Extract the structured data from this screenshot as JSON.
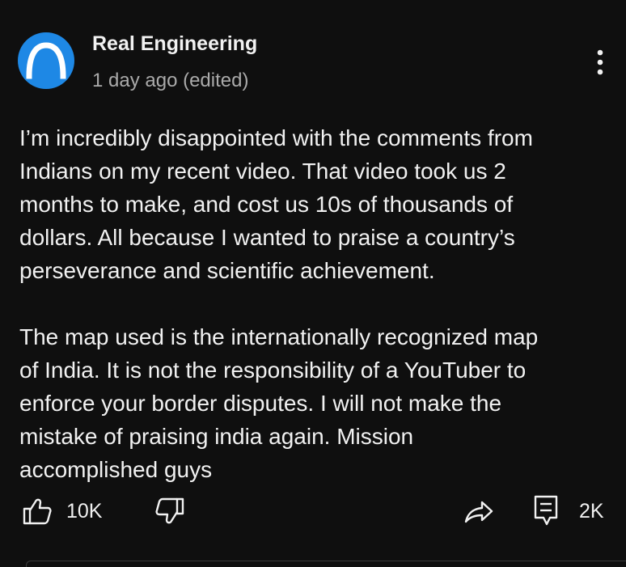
{
  "comment": {
    "author": "Real Engineering",
    "timestamp": "1 day ago (edited)",
    "avatar_icon": "arch-logo-icon",
    "avatar_color": "#1e88e5",
    "paragraphs": [
      [
        "I’m incredibly disappointed with the comments from",
        "Indians on my recent video. That video took us 2",
        "months to make, and cost us 10s of thousands of",
        "dollars. All because I wanted to praise a country’s",
        "perseverance and scientific achievement."
      ],
      [
        "The map used is the internationally recognized map",
        "of India. It is not the responsibility of a YouTuber to",
        "enforce your border disputes. I will not make the",
        "mistake of praising india again. Mission",
        "accomplished guys"
      ]
    ]
  },
  "actions": {
    "like_icon": "thumbs-up-icon",
    "like_count": "10K",
    "dislike_icon": "thumbs-down-icon",
    "share_icon": "share-icon",
    "replies_icon": "comment-icon",
    "reply_count": "2K",
    "more_icon": "more-vertical-icon"
  },
  "colors": {
    "background": "#0f0f0f",
    "text_primary": "#f1f1f1",
    "text_secondary": "#aaaaaa"
  }
}
